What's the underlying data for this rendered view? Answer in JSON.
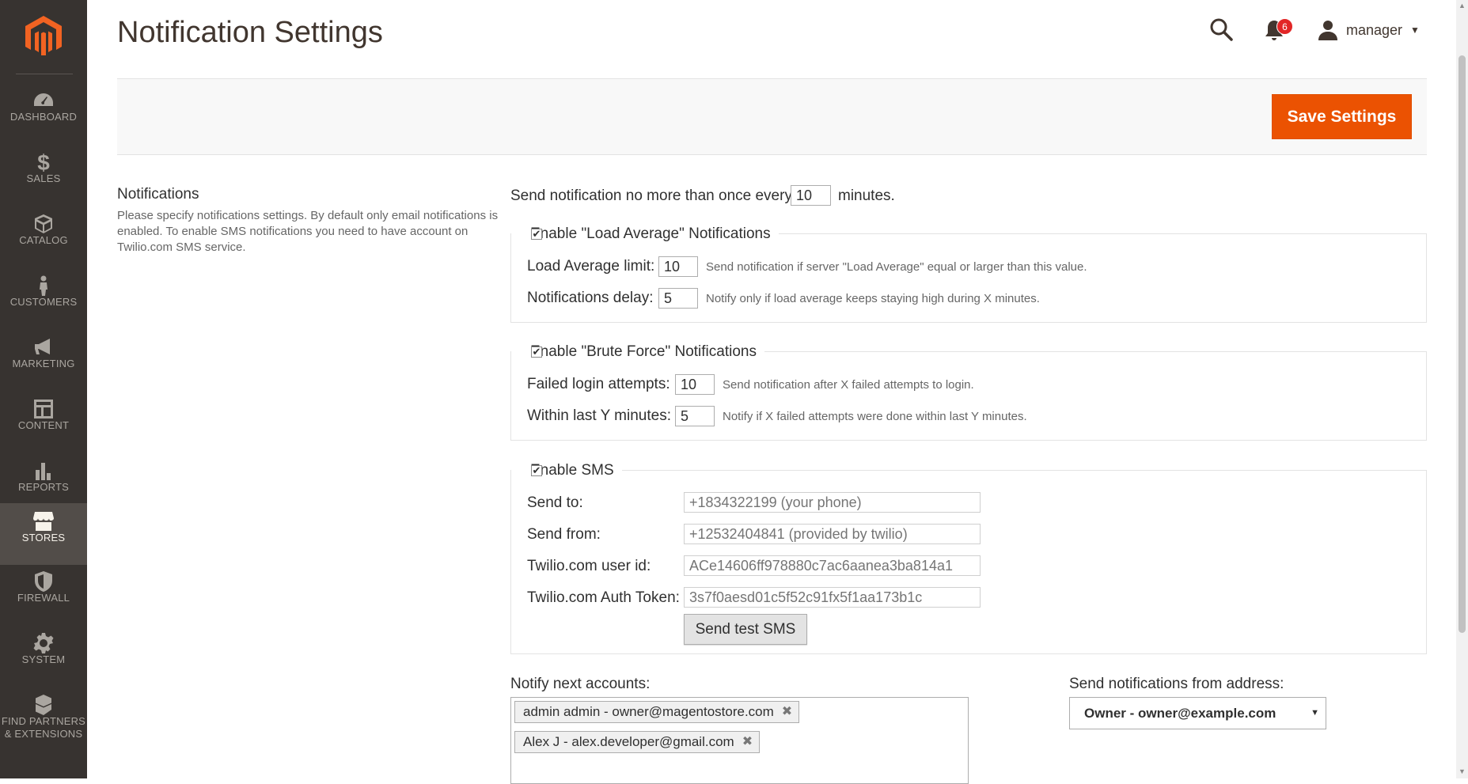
{
  "sidebar": {
    "items": [
      {
        "label": "DASHBOARD",
        "icon": "dashboard-icon"
      },
      {
        "label": "SALES",
        "icon": "dollar-icon"
      },
      {
        "label": "CATALOG",
        "icon": "cube-icon"
      },
      {
        "label": "CUSTOMERS",
        "icon": "person-icon"
      },
      {
        "label": "MARKETING",
        "icon": "megaphone-icon"
      },
      {
        "label": "CONTENT",
        "icon": "layout-icon"
      },
      {
        "label": "REPORTS",
        "icon": "bar-chart-icon"
      },
      {
        "label": "STORES",
        "icon": "storefront-icon"
      },
      {
        "label": "FIREWALL",
        "icon": "shield-icon"
      },
      {
        "label": "SYSTEM",
        "icon": "gear-icon"
      },
      {
        "label": "FIND PARTNERS",
        "label2": "& EXTENSIONS",
        "icon": "boxes-icon"
      }
    ],
    "active": "STORES"
  },
  "header": {
    "title": "Notification Settings",
    "notification_count": "6",
    "user_name": "manager"
  },
  "actions": {
    "save_label": "Save Settings"
  },
  "section": {
    "title": "Notifications",
    "description": "Please specify notifications settings. By default only email notifications is enabled. To enable SMS notifications you need to have account on Twilio.com SMS service."
  },
  "frequency": {
    "prefix": "Send notification no more than once every",
    "value": "10",
    "suffix": "minutes."
  },
  "load_average": {
    "legend": "Enable \"Load Average\" Notifications",
    "checked": true,
    "limit_label": "Load Average limit:",
    "limit_value": "10",
    "limit_help": "Send notification if server \"Load Average\" equal or larger than this value.",
    "delay_label": "Notifications delay:",
    "delay_value": "5",
    "delay_help": "Notify only if load average keeps staying high during X minutes."
  },
  "brute_force": {
    "legend": "Enable \"Brute Force\" Notifications",
    "checked": true,
    "attempts_label": "Failed login attempts:",
    "attempts_value": "10",
    "attempts_help": "Send notification after X failed attempts to login.",
    "minutes_label": "Within last Y minutes:",
    "minutes_value": "5",
    "minutes_help": "Notify if X failed attempts were done within last Y minutes."
  },
  "sms": {
    "legend": "Enable SMS",
    "checked": true,
    "send_to_label": "Send to:",
    "send_to_placeholder": "+1834322199 (your phone)",
    "send_from_label": "Send from:",
    "send_from_placeholder": "+12532404841 (provided by twilio)",
    "user_id_label": "Twilio.com user id:",
    "user_id_placeholder": "ACe14606ff978880c7ac6aanea3ba814a1",
    "token_label": "Twilio.com Auth Token:",
    "token_placeholder": "3s7f0aesd01c5f52c91fx5f1aa173b1c",
    "test_button": "Send test SMS"
  },
  "accounts": {
    "label": "Notify next accounts:",
    "tags": [
      "admin admin - owner@magentostore.com",
      "Alex J - alex.developer@gmail.com"
    ]
  },
  "from_address": {
    "label": "Send notifications from address:",
    "selected": "Owner - owner@example.com"
  },
  "colors": {
    "accent": "#eb5202",
    "sidebar": "#373330",
    "badge": "#e22626"
  }
}
